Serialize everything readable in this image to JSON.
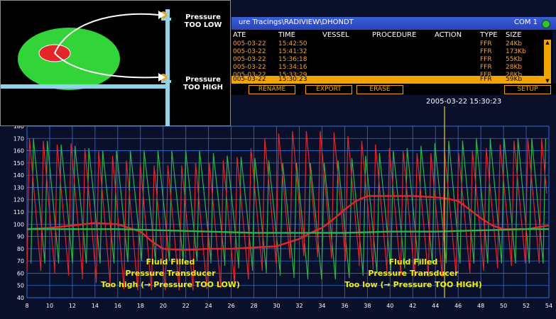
{
  "window": {
    "title": "ure Tracings\\RADIVIEW\\DHONDT",
    "com_label": "COM 1"
  },
  "list": {
    "columns": [
      "ATE",
      "TIME",
      "VESSEL",
      "PROCEDURE",
      "ACTION",
      "TYPE",
      "SIZE"
    ],
    "rows": [
      {
        "date": "005-03-22",
        "time": "15:42:50",
        "type": "FFR",
        "size": "24Kb",
        "selected": false
      },
      {
        "date": "005-03-22",
        "time": "15:41:32",
        "type": "FFR",
        "size": "173Kb",
        "selected": false
      },
      {
        "date": "005-03-22",
        "time": "15:36:18",
        "type": "FFR",
        "size": "55Kb",
        "selected": false
      },
      {
        "date": "005-03-22",
        "time": "15:34:16",
        "type": "FFR",
        "size": "28Kb",
        "selected": false
      },
      {
        "date": "005-03-22",
        "time": "15:33:29",
        "type": "FFR",
        "size": "28Kb",
        "selected": false
      },
      {
        "date": "005-03-22",
        "time": "15:30:23",
        "type": "FFR",
        "size": "59Kb",
        "selected": true
      }
    ]
  },
  "toolbar": {
    "rename": "RENAME",
    "export": "EXPORT",
    "erase": "ERASE",
    "setup": "SETUP"
  },
  "recording_timestamp": "2005-03-22 15:30:23",
  "inset": {
    "label_low": [
      "Pressure",
      "TOO LOW"
    ],
    "label_high": [
      "Pressure",
      "TOO HIGH"
    ]
  },
  "annotations": {
    "left": [
      "Fluid Filled",
      "Pressure Transducer",
      "Too high (→ Pressure TOO LOW)"
    ],
    "right": [
      "Fluid Filled",
      "Pressure Transducer",
      "Too low (→ Pressure TOO HIGH)"
    ]
  },
  "chart_data": {
    "type": "line",
    "xlim": [
      8,
      54
    ],
    "ylim": [
      40,
      180
    ],
    "x_ticks": [
      8,
      10,
      12,
      14,
      16,
      18,
      20,
      22,
      24,
      26,
      28,
      30,
      32,
      34,
      36,
      38,
      40,
      42,
      44,
      46,
      48,
      50,
      52,
      54
    ],
    "y_ticks": [
      40,
      50,
      60,
      70,
      80,
      90,
      100,
      110,
      120,
      130,
      140,
      150,
      160,
      170,
      180
    ],
    "grid": true,
    "colors": {
      "grid": "#2f6fd8",
      "red": "#e3262a",
      "green": "#2fb34a",
      "marker": "#e6d319"
    },
    "marker_x": 44.8,
    "series": [
      {
        "id": "red-mean",
        "color": "#e3262a",
        "x": [
          8,
          10,
          12,
          14,
          16,
          18,
          19,
          20,
          22,
          24,
          26,
          28,
          30,
          31,
          32,
          33,
          34,
          35,
          36,
          37,
          38,
          40,
          42,
          44,
          45,
          46,
          47,
          48,
          49,
          50,
          52,
          54
        ],
        "y": [
          96,
          97,
          99,
          101,
          100,
          94,
          86,
          80,
          79,
          80,
          80,
          81,
          82,
          85,
          88,
          93,
          97,
          104,
          112,
          119,
          123,
          123,
          123,
          122,
          121,
          119,
          112,
          105,
          99,
          96,
          96,
          99
        ]
      },
      {
        "id": "green-mean",
        "color": "#2fb34a",
        "x": [
          8,
          12,
          16,
          20,
          24,
          28,
          32,
          36,
          40,
          44,
          48,
          52,
          54
        ],
        "y": [
          96,
          96,
          96,
          95,
          94,
          93,
          93,
          93,
          94,
          94,
          95,
          96,
          96
        ]
      }
    ],
    "pulsatile": {
      "beat_period": 1.22,
      "red_systolic": [
        170,
        168,
        165,
        166,
        162,
        160,
        156,
        152,
        150,
        148,
        148,
        148,
        150,
        150,
        152,
        155,
        162,
        170,
        174,
        176,
        176,
        176,
        175,
        172,
        168,
        165,
        162,
        160,
        158,
        158,
        158,
        158,
        160,
        162,
        165,
        168,
        170,
        170
      ],
      "red_diastolic": [
        62,
        62,
        60,
        58,
        55,
        52,
        48,
        47,
        46,
        46,
        46,
        46,
        47,
        48,
        50,
        55,
        62,
        68,
        72,
        74,
        74,
        73,
        72,
        70,
        66,
        63,
        60,
        58,
        57,
        57,
        58,
        60,
        62,
        64,
        66,
        68,
        68,
        68
      ],
      "green_systolic": [
        170,
        168,
        165,
        164,
        162,
        160,
        160,
        160,
        160,
        160,
        160,
        160,
        160,
        158,
        156,
        155,
        154,
        152,
        150,
        150,
        150,
        150,
        152,
        154,
        156,
        158,
        160,
        162,
        164,
        166,
        168,
        168,
        170,
        170,
        170,
        170,
        170,
        170
      ],
      "green_diastolic": [
        68,
        68,
        68,
        68,
        68,
        68,
        69,
        70,
        70,
        70,
        70,
        70,
        70,
        68,
        66,
        64,
        62,
        60,
        58,
        56,
        55,
        55,
        56,
        58,
        60,
        62,
        64,
        66,
        68,
        68,
        68,
        68,
        68,
        68,
        68,
        68,
        68,
        68
      ]
    }
  }
}
